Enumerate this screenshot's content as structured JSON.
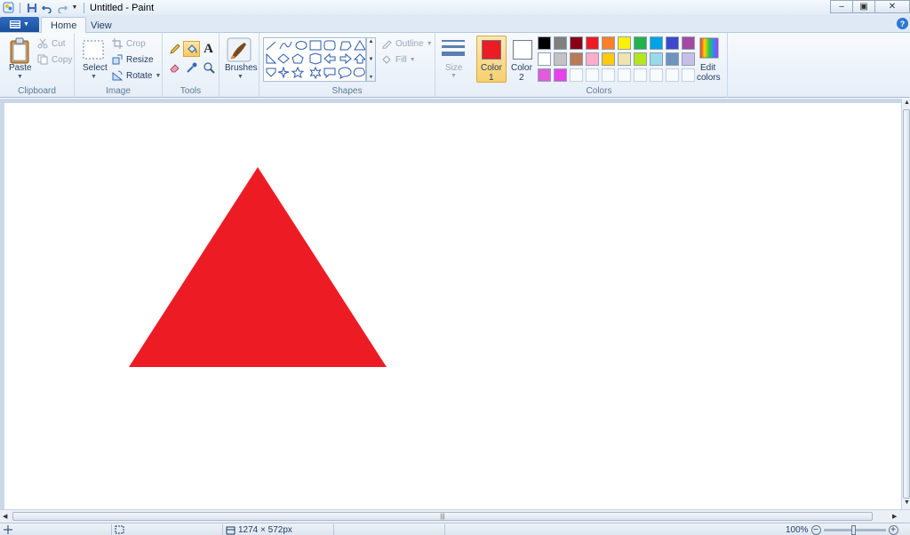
{
  "window": {
    "title": "Untitled - Paint",
    "minimize_glyph": "–",
    "maximize_glyph": "▣",
    "close_glyph": "✕"
  },
  "tabs": {
    "home": "Home",
    "view": "View"
  },
  "ribbon": {
    "clipboard": {
      "label": "Clipboard",
      "paste": "Paste",
      "cut": "Cut",
      "copy": "Copy"
    },
    "image": {
      "label": "Image",
      "select": "Select",
      "crop": "Crop",
      "resize": "Resize",
      "rotate": "Rotate"
    },
    "tools": {
      "label": "Tools",
      "text_tool_glyph": "A"
    },
    "brushes": {
      "label": "Brushes"
    },
    "shapes": {
      "label": "Shapes",
      "outline": "Outline",
      "fill": "Fill"
    },
    "size": {
      "label": "Size"
    },
    "colors": {
      "label": "Colors",
      "color1": "Color",
      "color1_num": "1",
      "color2": "Color",
      "color2_num": "2",
      "edit": "Edit",
      "edit2": "colors",
      "color1_value": "#ed1c24",
      "color2_value": "#ffffff",
      "palette_row1": [
        "#000000",
        "#7f7f7f",
        "#880015",
        "#ed1c24",
        "#ff7f27",
        "#fff200",
        "#22b14c",
        "#00a2e8",
        "#3f48cc",
        "#a349a4"
      ],
      "palette_row2": [
        "#ffffff",
        "#c3c3c3",
        "#b97a57",
        "#ffaec9",
        "#ffc90e",
        "#efe4b0",
        "#b5e61d",
        "#99d9ea",
        "#7092be",
        "#c8bfe7"
      ],
      "palette_row3": [
        "#e15cd9",
        "#e841ec"
      ]
    }
  },
  "canvas": {
    "shape_color": "#ed1c24"
  },
  "status": {
    "size": "1274 × 572px",
    "zoom": "100%"
  }
}
